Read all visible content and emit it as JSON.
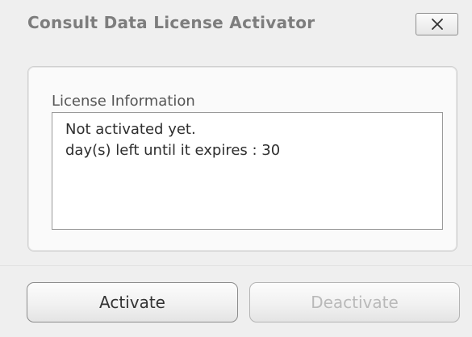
{
  "window": {
    "title": "Consult Data License Activator",
    "close_icon": "close-x-icon"
  },
  "license_group": {
    "label": "License Information",
    "lines": [
      "Not activated yet.",
      "day(s) left until it expires : 30"
    ]
  },
  "buttons": {
    "activate_label": "Activate",
    "deactivate_label": "Deactivate",
    "deactivate_enabled": false
  },
  "colors": {
    "background": "#efefef",
    "panel": "#fafafa",
    "text": "#2e2e2e",
    "title": "#7d7d7d",
    "disabled_text": "#b9b9b9"
  }
}
